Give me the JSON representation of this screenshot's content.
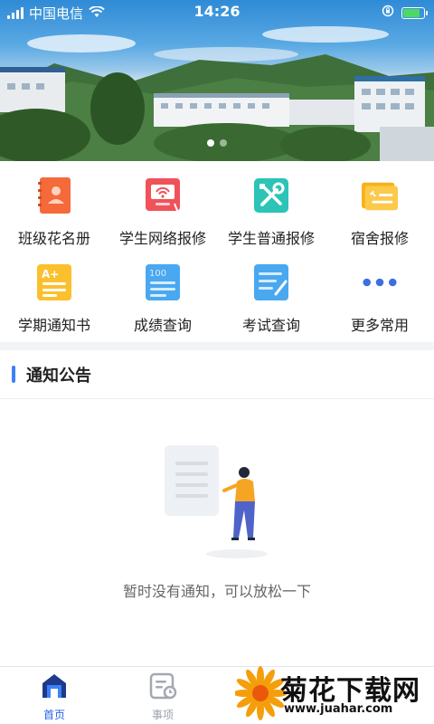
{
  "status_bar": {
    "carrier": "中国电信",
    "time": "14:26",
    "battery_level": 0.85
  },
  "banner": {
    "slides": 2,
    "active_slide": 1
  },
  "grid": [
    {
      "label": "班级花名册",
      "icon": "roster-icon",
      "color": "#f56a3a"
    },
    {
      "label": "学生网络报修",
      "icon": "network-repair-icon",
      "color": "#f0525a"
    },
    {
      "label": "学生普通报修",
      "icon": "tools-icon",
      "color": "#2bc4b6"
    },
    {
      "label": "宿舍报修",
      "icon": "dorm-repair-icon",
      "color": "#f7b21c"
    },
    {
      "label": "学期通知书",
      "icon": "report-card-icon",
      "color": "#fbc02d"
    },
    {
      "label": "成绩查询",
      "icon": "score-icon",
      "color": "#4aa8f0"
    },
    {
      "label": "考试查询",
      "icon": "exam-icon",
      "color": "#4aa8f0"
    },
    {
      "label": "更多常用",
      "icon": "more-icon",
      "color": "#3b6fe0"
    }
  ],
  "notice": {
    "title": "通知公告",
    "empty_text": "暂时没有通知，可以放松一下"
  },
  "tabs": [
    {
      "label": "首页",
      "icon": "home-icon",
      "active": true
    },
    {
      "label": "事项",
      "icon": "tasks-icon",
      "active": false
    }
  ],
  "watermark": {
    "title": "菊花下载网",
    "url": "www.juahar.com"
  },
  "colors": {
    "accent": "#2563eb",
    "section_bar": "#3b82f6"
  }
}
